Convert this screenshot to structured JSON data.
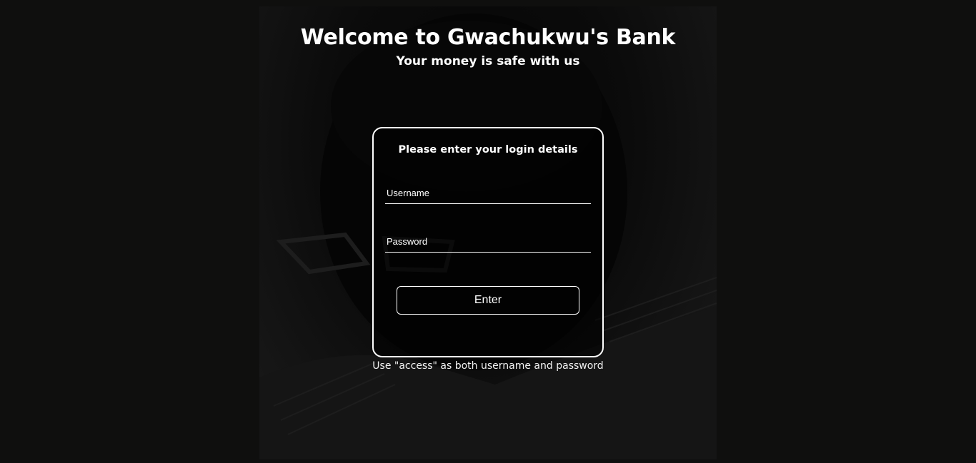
{
  "header": {
    "title": "Welcome to Gwachukwu's Bank",
    "subtitle": "Your money is safe with us"
  },
  "login": {
    "heading": "Please enter your login details",
    "username_placeholder": "Username",
    "password_placeholder": "Password",
    "enter_label": "Enter"
  },
  "hint": "Use \"access\" as both username and password",
  "colors": {
    "page_background": "#0f0f0e",
    "text": "#ffffff",
    "border": "#ffffff"
  }
}
